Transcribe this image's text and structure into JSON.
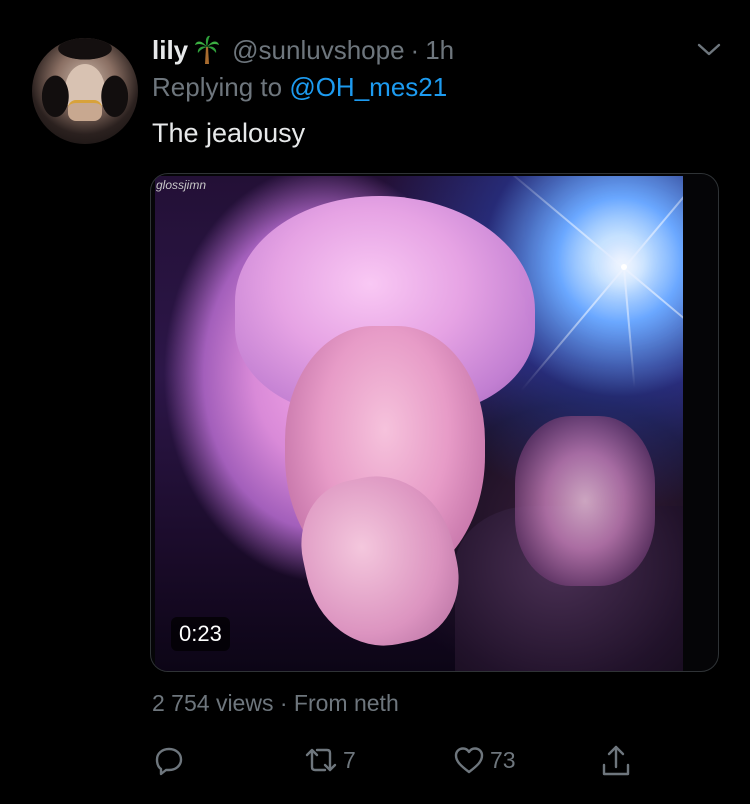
{
  "tweet": {
    "display_name": "lily",
    "name_emoji": "palm-tree",
    "handle": "@sunluvshope",
    "separator": "·",
    "time": "1h",
    "reply_prefix": "Replying to",
    "reply_to": "@OH_mes21",
    "text": "The jealousy"
  },
  "media": {
    "watermark": "glossjimn",
    "duration": "0:23"
  },
  "meta": {
    "views": "2 754 views",
    "separator": "·",
    "source": "From neth"
  },
  "actions": {
    "reply_icon": "reply-icon",
    "retweet_icon": "retweet-icon",
    "retweet_count": "7",
    "like_icon": "heart-icon",
    "like_count": "73",
    "share_icon": "share-icon"
  },
  "colors": {
    "background": "#000000",
    "primary_text": "#e7e9ea",
    "secondary_text": "#6e767d",
    "link": "#1d9bf0",
    "border": "#2f3336"
  }
}
